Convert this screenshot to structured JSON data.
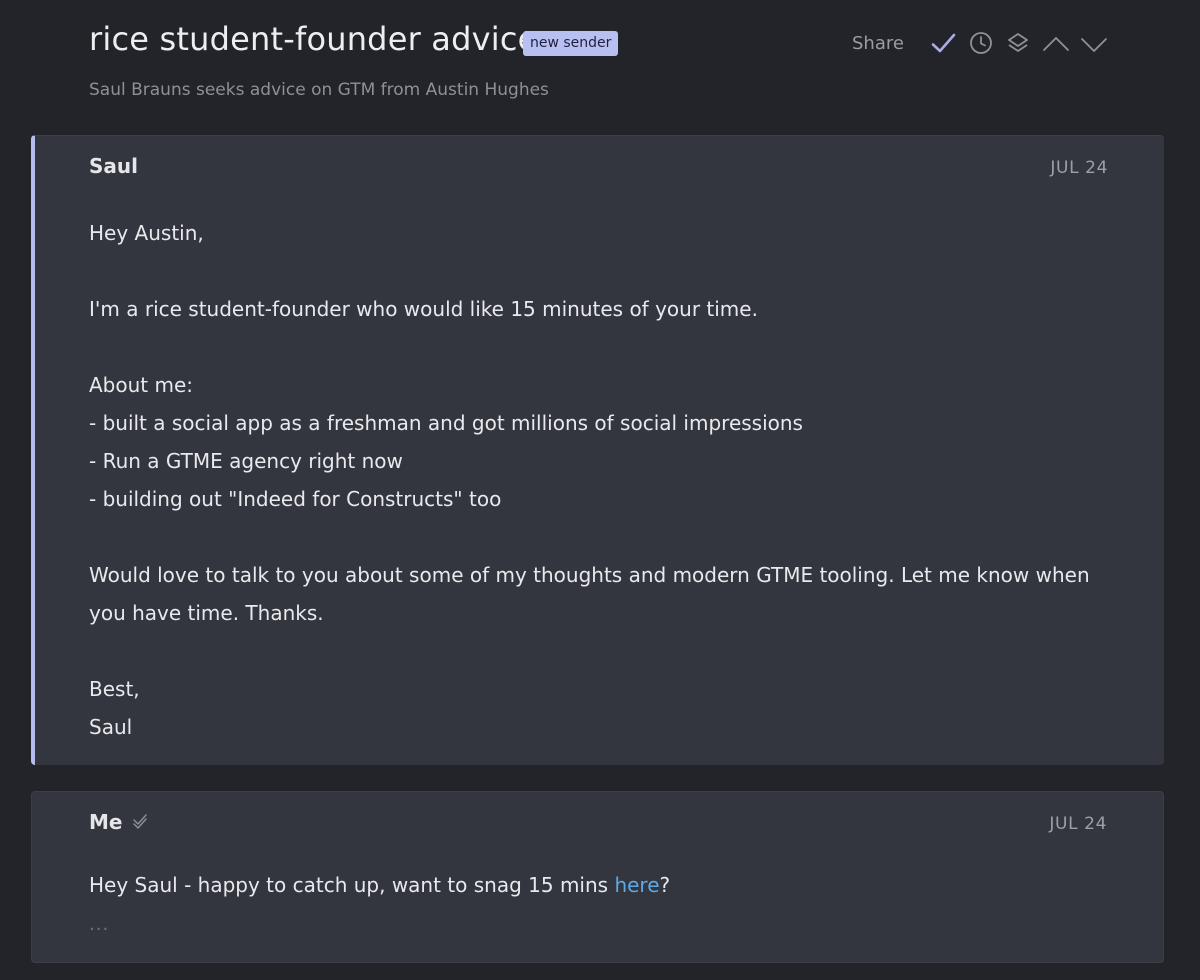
{
  "thread": {
    "subject": "rice student-founder advice",
    "badge": "new sender",
    "summary": "Saul Brauns seeks advice on GTM from Austin Hughes"
  },
  "toolbar": {
    "share_label": "Share",
    "icons": [
      "check-icon",
      "clock-icon",
      "layers-icon",
      "chevron-up-icon",
      "chevron-down-icon"
    ]
  },
  "messages": [
    {
      "sender": "Saul",
      "date": "JUL 24",
      "lines": {
        "greeting": "Hey Austin,",
        "intro": "I'm a rice student-founder who would like 15 minutes of your time.",
        "about": "About me:",
        "bullet1": "- built a social app as a freshman and got millions of social impressions",
        "bullet2": "- Run a GTME agency right now",
        "bullet3": "- building out \"Indeed for Constructs\" too",
        "closing": "Would love to talk to you about some of my thoughts and modern GTME tooling. Let me know when you have time. Thanks.",
        "signoff": "Best,",
        "signature": "Saul"
      }
    },
    {
      "sender": "Me",
      "date": "JUL 24",
      "reply_before": "Hey Saul - happy to catch up, want to snag 15 mins ",
      "reply_link": "here",
      "reply_after": "?",
      "ellipsis": "..."
    }
  ],
  "colors": {
    "background": "#232429",
    "card": "#33363e",
    "accent": "#b5bcf0",
    "link": "#5fa8e6"
  }
}
